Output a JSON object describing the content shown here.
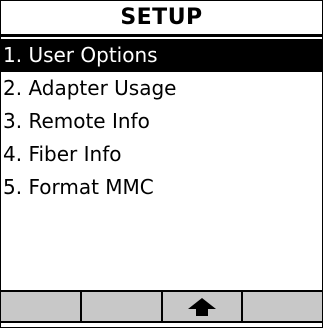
{
  "header": {
    "title": "SETUP"
  },
  "menu": {
    "selected_index": 0,
    "items": [
      {
        "label": "1. User Options"
      },
      {
        "label": "2. Adapter Usage"
      },
      {
        "label": "3. Remote Info"
      },
      {
        "label": "4. Fiber Info"
      },
      {
        "label": "5. Format MMC"
      }
    ]
  },
  "softkeys": [
    {
      "label": "",
      "icon": null
    },
    {
      "label": "",
      "icon": null
    },
    {
      "label": "",
      "icon": "up-arrow-icon"
    },
    {
      "label": "",
      "icon": null
    }
  ],
  "colors": {
    "selection_bg": "#000000",
    "selection_fg": "#ffffff",
    "softkey_bg": "#c8c8c8"
  }
}
